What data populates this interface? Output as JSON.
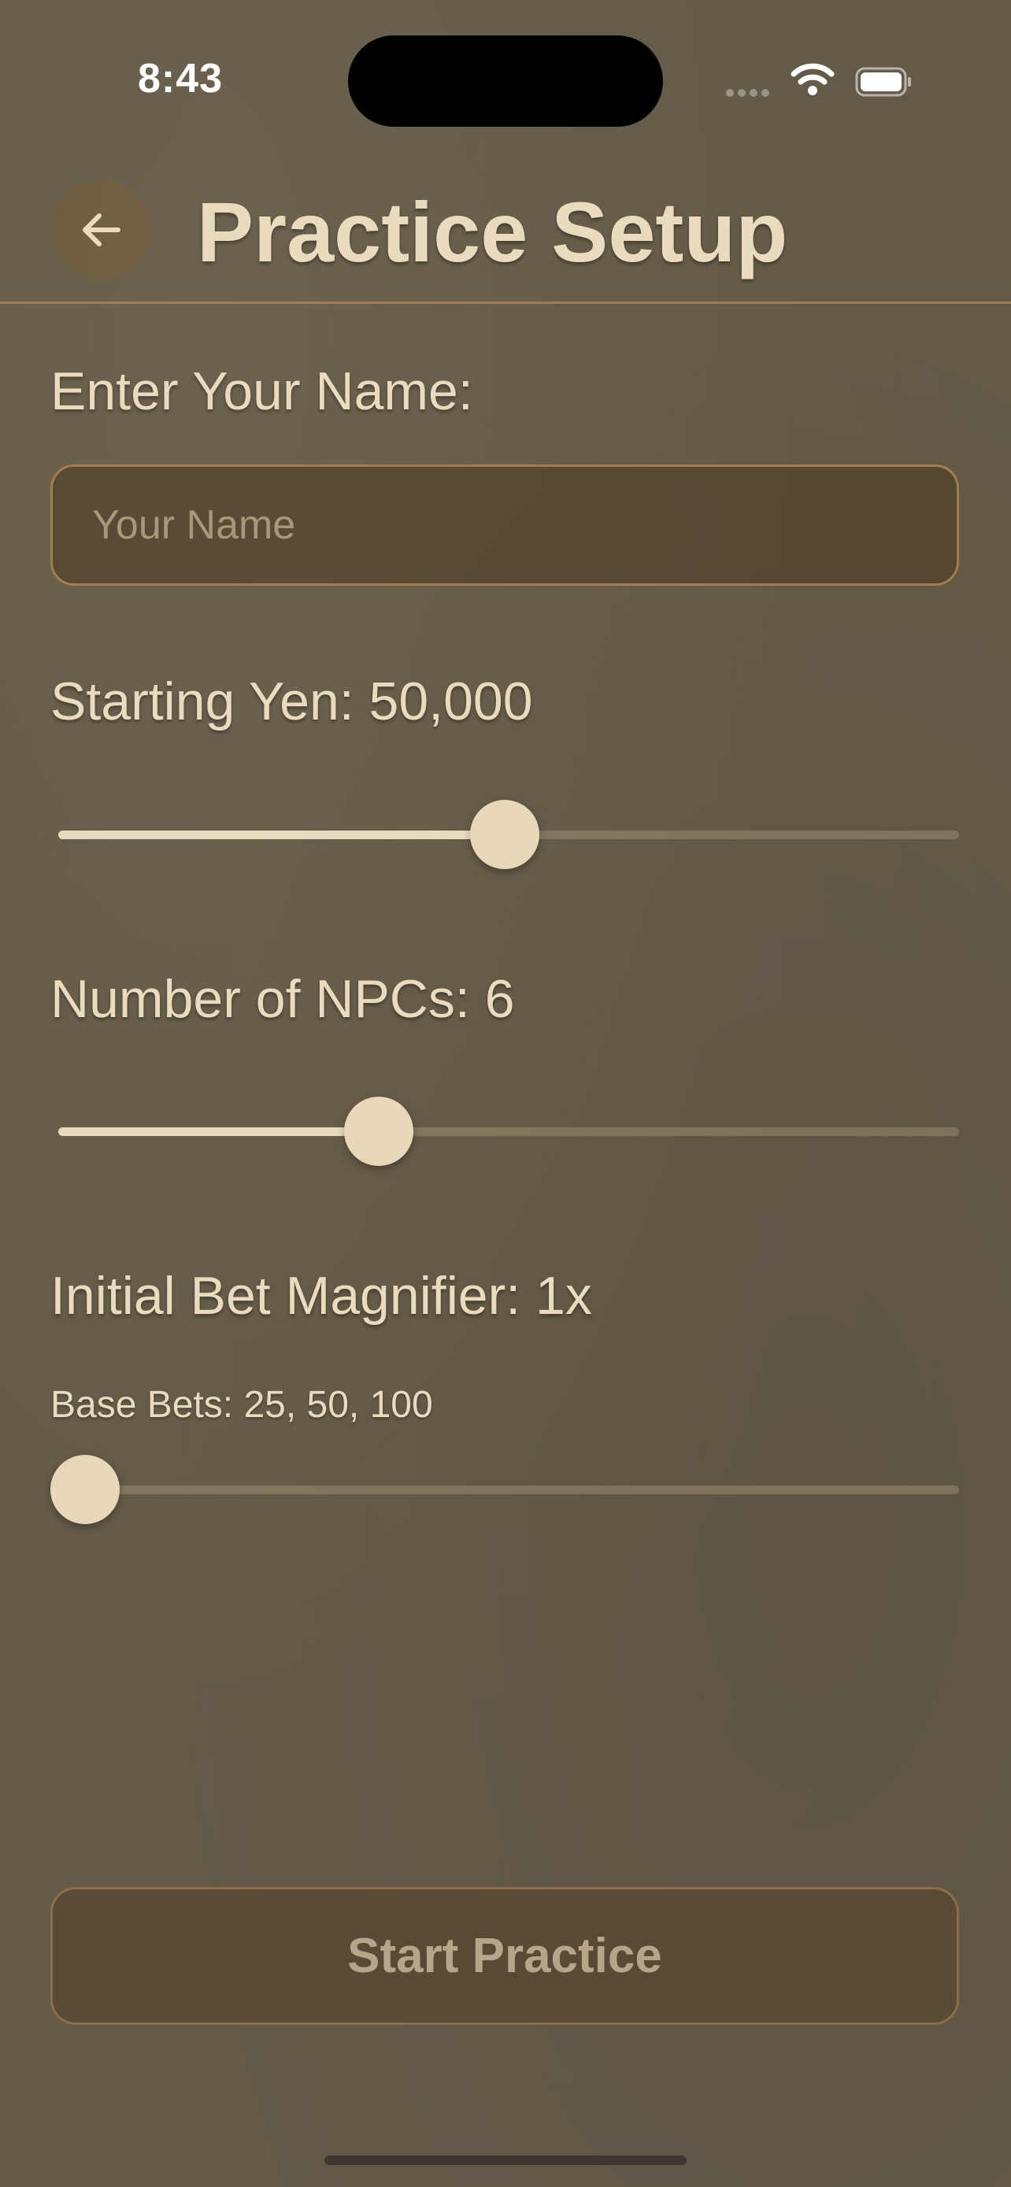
{
  "status_bar": {
    "time": "8:43"
  },
  "header": {
    "back_icon": "arrow-left-icon",
    "title": "Practice Setup"
  },
  "name_section": {
    "label": "Enter Your Name:",
    "input_value": "",
    "input_placeholder": "Your Name"
  },
  "starting_yen": {
    "label": "Starting Yen: 50,000",
    "slider_fraction": 0.5
  },
  "npcs": {
    "label": "Number of NPCs: 6",
    "slider_fraction": 0.35
  },
  "bet_magnifier": {
    "label": "Initial Bet Magnifier: 1x",
    "base_bets": "Base Bets: 25, 50, 100",
    "slider_fraction": 0.0
  },
  "start_button": {
    "label": "Start Practice"
  },
  "colors": {
    "background": "#635A48",
    "text": "#EADBBE",
    "accent_border": "#A27E4D",
    "disabled_text": "#B5A68A"
  }
}
